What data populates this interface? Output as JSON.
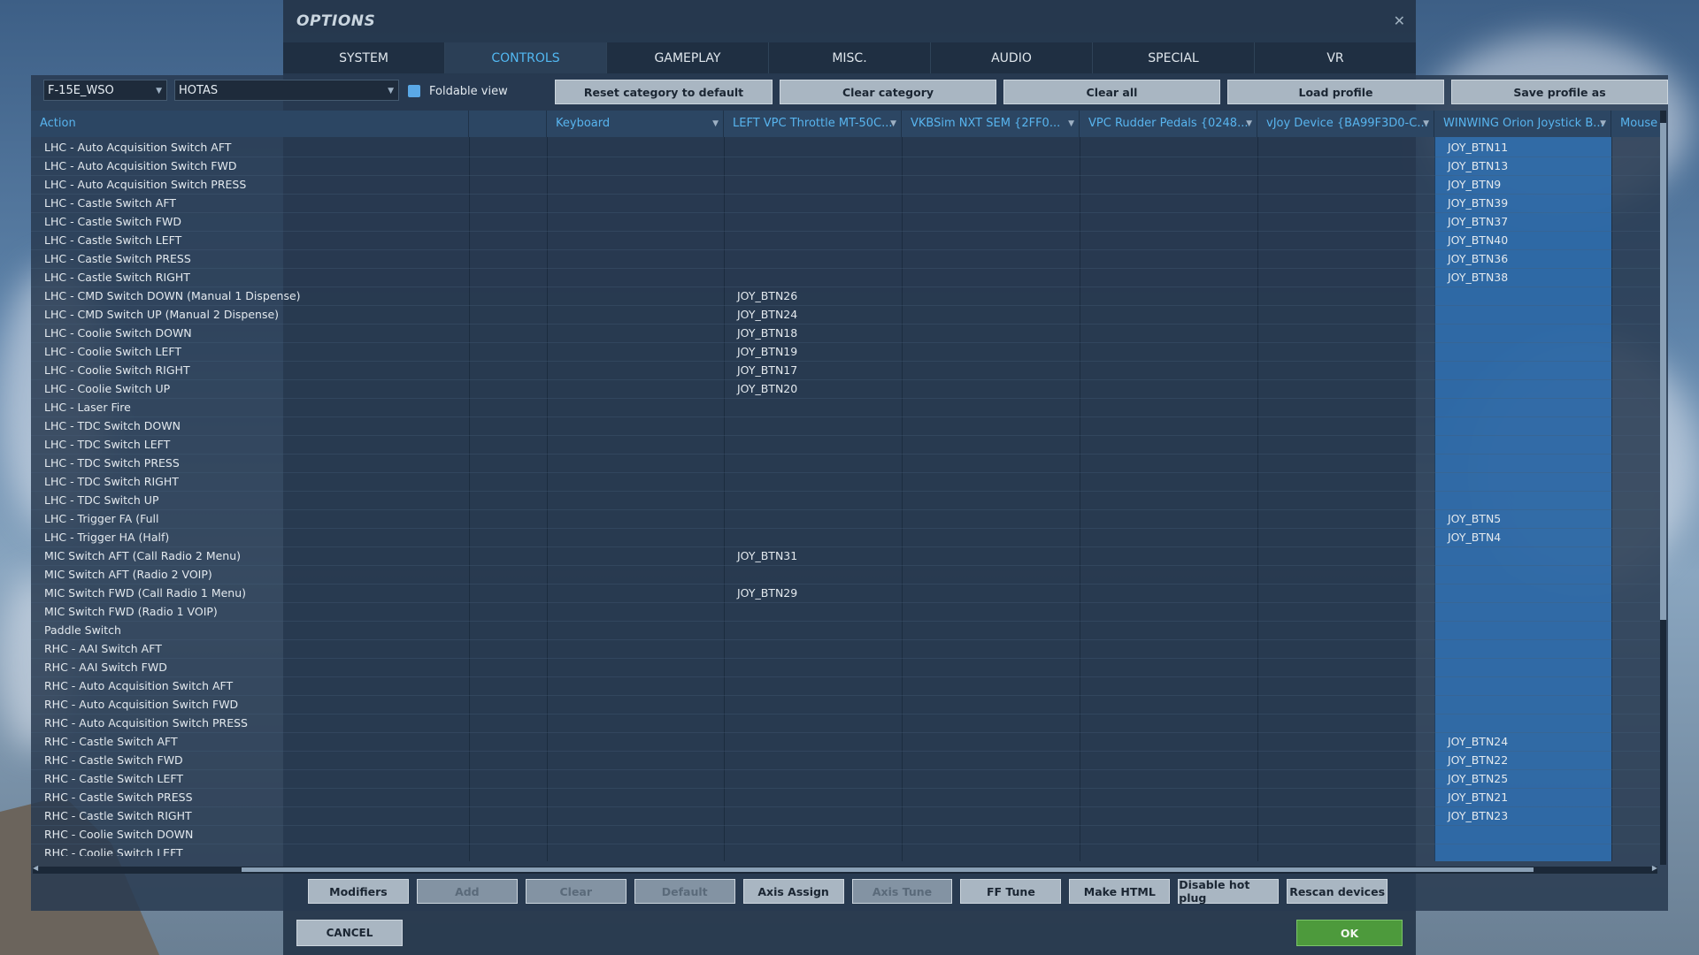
{
  "window": {
    "title": "OPTIONS",
    "close_glyph": "✕"
  },
  "tabs": [
    {
      "label": "SYSTEM",
      "active": false
    },
    {
      "label": "CONTROLS",
      "active": true
    },
    {
      "label": "GAMEPLAY",
      "active": false
    },
    {
      "label": "MISC.",
      "active": false
    },
    {
      "label": "AUDIO",
      "active": false
    },
    {
      "label": "SPECIAL",
      "active": false
    },
    {
      "label": "VR",
      "active": false
    }
  ],
  "toolbar": {
    "aircraft_select": "F-15E_WSO",
    "category_select": "HOTAS",
    "foldable_label": "Foldable view",
    "reset_label": "Reset category to default",
    "clear_category_label": "Clear category",
    "clear_all_label": "Clear all",
    "load_profile_label": "Load profile",
    "save_profile_label": "Save profile as"
  },
  "columns": {
    "action": "Action",
    "blank": "",
    "keyboard": "Keyboard",
    "left_vpc": "LEFT VPC Throttle MT-50C...",
    "vkbsim": "VKBSim NXT SEM  {2FF0...",
    "vpc_rudder": "VPC Rudder Pedals {0248...",
    "vjoy": "vJoy Device {BA99F3D0-C...",
    "winwing": "WINWING Orion Joystick B...",
    "mouse": "Mouse"
  },
  "rows": [
    {
      "action": "LHC - Auto Acquisition Switch AFT",
      "left_vpc": "",
      "winwing": "JOY_BTN11"
    },
    {
      "action": "LHC - Auto Acquisition Switch FWD",
      "left_vpc": "",
      "winwing": "JOY_BTN13"
    },
    {
      "action": "LHC - Auto Acquisition Switch PRESS",
      "left_vpc": "",
      "winwing": "JOY_BTN9"
    },
    {
      "action": "LHC - Castle Switch AFT",
      "left_vpc": "",
      "winwing": "JOY_BTN39"
    },
    {
      "action": "LHC - Castle Switch FWD",
      "left_vpc": "",
      "winwing": "JOY_BTN37"
    },
    {
      "action": "LHC - Castle Switch LEFT",
      "left_vpc": "",
      "winwing": "JOY_BTN40"
    },
    {
      "action": "LHC - Castle Switch PRESS",
      "left_vpc": "",
      "winwing": "JOY_BTN36"
    },
    {
      "action": "LHC - Castle Switch RIGHT",
      "left_vpc": "",
      "winwing": "JOY_BTN38"
    },
    {
      "action": "LHC - CMD Switch DOWN (Manual 1 Dispense)",
      "left_vpc": "JOY_BTN26",
      "winwing": ""
    },
    {
      "action": "LHC - CMD Switch UP (Manual 2 Dispense)",
      "left_vpc": "JOY_BTN24",
      "winwing": ""
    },
    {
      "action": "LHC - Coolie Switch DOWN",
      "left_vpc": "JOY_BTN18",
      "winwing": ""
    },
    {
      "action": "LHC - Coolie Switch LEFT",
      "left_vpc": "JOY_BTN19",
      "winwing": ""
    },
    {
      "action": "LHC - Coolie Switch RIGHT",
      "left_vpc": "JOY_BTN17",
      "winwing": ""
    },
    {
      "action": "LHC - Coolie Switch UP",
      "left_vpc": "JOY_BTN20",
      "winwing": ""
    },
    {
      "action": "LHC - Laser Fire",
      "left_vpc": "",
      "winwing": ""
    },
    {
      "action": "LHC - TDC Switch DOWN",
      "left_vpc": "",
      "winwing": ""
    },
    {
      "action": "LHC - TDC Switch LEFT",
      "left_vpc": "",
      "winwing": ""
    },
    {
      "action": "LHC - TDC Switch PRESS",
      "left_vpc": "",
      "winwing": ""
    },
    {
      "action": "LHC - TDC Switch RIGHT",
      "left_vpc": "",
      "winwing": ""
    },
    {
      "action": "LHC - TDC Switch UP",
      "left_vpc": "",
      "winwing": ""
    },
    {
      "action": "LHC - Trigger FA (Full",
      "left_vpc": "",
      "winwing": "JOY_BTN5"
    },
    {
      "action": "LHC - Trigger HA (Half)",
      "left_vpc": "",
      "winwing": "JOY_BTN4"
    },
    {
      "action": "MIC Switch AFT (Call Radio 2 Menu)",
      "left_vpc": "JOY_BTN31",
      "winwing": ""
    },
    {
      "action": "MIC Switch AFT (Radio 2 VOIP)",
      "left_vpc": "",
      "winwing": ""
    },
    {
      "action": "MIC Switch FWD (Call Radio 1 Menu)",
      "left_vpc": "JOY_BTN29",
      "winwing": ""
    },
    {
      "action": "MIC Switch FWD (Radio 1 VOIP)",
      "left_vpc": "",
      "winwing": ""
    },
    {
      "action": "Paddle Switch",
      "left_vpc": "",
      "winwing": ""
    },
    {
      "action": "RHC - AAI Switch AFT",
      "left_vpc": "",
      "winwing": ""
    },
    {
      "action": "RHC - AAI Switch FWD",
      "left_vpc": "",
      "winwing": ""
    },
    {
      "action": "RHC - Auto Acquisition Switch AFT",
      "left_vpc": "",
      "winwing": ""
    },
    {
      "action": "RHC - Auto Acquisition Switch FWD",
      "left_vpc": "",
      "winwing": ""
    },
    {
      "action": "RHC - Auto Acquisition Switch PRESS",
      "left_vpc": "",
      "winwing": ""
    },
    {
      "action": "RHC - Castle Switch AFT",
      "left_vpc": "",
      "winwing": "JOY_BTN24"
    },
    {
      "action": "RHC - Castle Switch FWD",
      "left_vpc": "",
      "winwing": "JOY_BTN22"
    },
    {
      "action": "RHC - Castle Switch LEFT",
      "left_vpc": "",
      "winwing": "JOY_BTN25"
    },
    {
      "action": "RHC - Castle Switch PRESS",
      "left_vpc": "",
      "winwing": "JOY_BTN21"
    },
    {
      "action": "RHC - Castle Switch RIGHT",
      "left_vpc": "",
      "winwing": "JOY_BTN23"
    },
    {
      "action": "RHC - Coolie Switch DOWN",
      "left_vpc": "",
      "winwing": ""
    },
    {
      "action": "RHC - Coolie Switch LEFT",
      "left_vpc": "",
      "winwing": ""
    }
  ],
  "bottom_buttons": [
    {
      "label": "Modifiers",
      "enabled": true
    },
    {
      "label": "Add",
      "enabled": false
    },
    {
      "label": "Clear",
      "enabled": false
    },
    {
      "label": "Default",
      "enabled": false
    },
    {
      "label": "Axis Assign",
      "enabled": true
    },
    {
      "label": "Axis Tune",
      "enabled": false
    },
    {
      "label": "FF Tune",
      "enabled": true
    },
    {
      "label": "Make HTML",
      "enabled": true
    },
    {
      "label": "Disable hot plug",
      "enabled": true
    },
    {
      "label": "Rescan devices",
      "enabled": true
    }
  ],
  "footer": {
    "cancel_label": "CANCEL",
    "ok_label": "OK"
  },
  "icons": {
    "close": "close-icon",
    "dropdown": "chevron-down-icon",
    "scroll_left": "arrow-left-icon",
    "scroll_right": "arrow-right-icon",
    "scroll_up": "arrow-up-icon"
  },
  "colors": {
    "accent": "#52b8f2",
    "ok": "#4d9a3c",
    "selected_column": "#2f76be"
  }
}
